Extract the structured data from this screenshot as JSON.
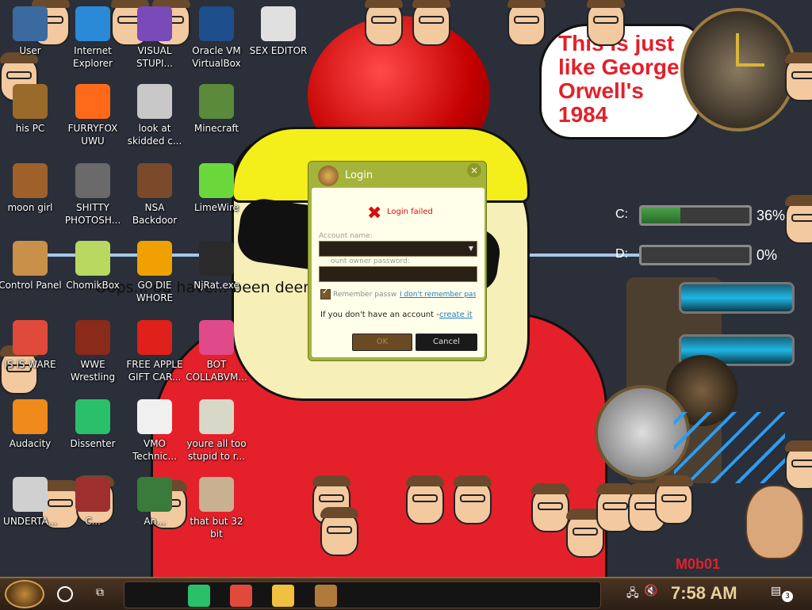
{
  "desktop": {
    "wallpaper": {
      "banner_text": "Oops... ou have... been deemed inap",
      "speech_bubble": "This is just like George Orwell's 1984"
    },
    "icons": [
      {
        "label": "User",
        "icon": "user-folder-icon",
        "color": "#3a6aa0"
      },
      {
        "label": "Internet Explorer",
        "icon": "internet-explorer-icon",
        "color": "#2a8ad8"
      },
      {
        "label": "VISUAL STUPI...",
        "icon": "visual-studio-icon",
        "color": "#7a4ab8"
      },
      {
        "label": "Oracle VM VirtualBox",
        "icon": "virtualbox-icon",
        "color": "#1e4e8c"
      },
      {
        "label": "SEX EDITOR",
        "icon": "hxd-editor-icon",
        "color": "#e0e0e0"
      },
      {
        "label": "his PC",
        "icon": "this-pc-icon",
        "color": "#9a6a2a"
      },
      {
        "label": "FURRYFOX UWU",
        "icon": "firefox-icon",
        "color": "#ff6a1a"
      },
      {
        "label": "look at skidded c...",
        "icon": "files-stack-icon",
        "color": "#c8c8c8"
      },
      {
        "label": "Minecraft",
        "icon": "minecraft-icon",
        "color": "#5a8a3a"
      },
      {
        "label": "moon girl",
        "icon": "folder-icon",
        "color": "#a0602a"
      },
      {
        "label": "SHITTY PHOTOSH...",
        "icon": "gimp-icon",
        "color": "#6a6a6a"
      },
      {
        "label": "NSA Backdoor",
        "icon": "nsa-backdoor-icon",
        "color": "#7a4a2a"
      },
      {
        "label": "LimeWire",
        "icon": "limewire-icon",
        "color": "#6ad83a"
      },
      {
        "label": "Control Panel",
        "icon": "control-panel-icon",
        "color": "#c89048"
      },
      {
        "label": "ChomikBox",
        "icon": "chomikbox-icon",
        "color": "#b8d860"
      },
      {
        "label": "GO DIE WHORE",
        "icon": "adobe-de-icon",
        "color": "#f0a000"
      },
      {
        "label": "NjRat.exe",
        "icon": "skull-icon",
        "color": "#2a2a2a"
      },
      {
        "label": "IS IS WARE",
        "icon": "chrome-icon",
        "color": "#e04a3a"
      },
      {
        "label": "WWE Wrestling",
        "icon": "tv-oven-icon",
        "color": "#8a2a1a"
      },
      {
        "label": "FREE APPLE GIFT CAR...",
        "icon": "apple-icon",
        "color": "#e0201a"
      },
      {
        "label": "BOT COLLABVM...",
        "icon": "monitor-icon",
        "color": "#e04a8a"
      },
      {
        "label": "Audacity",
        "icon": "audacity-icon",
        "color": "#f08a1a"
      },
      {
        "label": "Dissenter",
        "icon": "dissenter-icon",
        "color": "#2ac06a"
      },
      {
        "label": "VMO Technic...",
        "icon": "doctor-icon",
        "color": "#f0f0f0"
      },
      {
        "label": "youre all too stupid to r...",
        "icon": "portrait-icon",
        "color": "#d8d8c8"
      },
      {
        "label": "UNDERTA...",
        "icon": "unity-icon",
        "color": "#d0d0d0"
      },
      {
        "label": "C...",
        "icon": "game-icon",
        "color": "#a03030"
      },
      {
        "label": "An...",
        "icon": "shield-icon",
        "color": "#3a7a3a"
      },
      {
        "label": "that but 32 bit",
        "icon": "portrait-icon",
        "color": "#c8b090"
      }
    ]
  },
  "login_dialog": {
    "title": "Login",
    "error": "Login failed",
    "account_name_label": "Account name:",
    "password_label": "ount owner password:",
    "remember_label": "Remember passw",
    "forgot_link": "I don't remember pas",
    "no_account_text": "If you don't have an account -",
    "create_link": "create it",
    "ok_label": "OK",
    "cancel_label": "Cancel"
  },
  "drives": [
    {
      "letter": "C:",
      "percent_text": "36%",
      "percent": 36
    },
    {
      "letter": "D:",
      "percent_text": "0%",
      "percent": 0
    }
  ],
  "watermark": "M0b01",
  "taskbar": {
    "time": "7:58 AM",
    "notification_count": "3",
    "pinned": [
      {
        "name": "dissenter-icon",
        "color": "#2ac06a"
      },
      {
        "name": "chrome-icon",
        "color": "#e04a3a"
      },
      {
        "name": "file-explorer-icon",
        "color": "#f0c040"
      },
      {
        "name": "chomikbox-icon",
        "color": "#b07a3a"
      }
    ]
  }
}
